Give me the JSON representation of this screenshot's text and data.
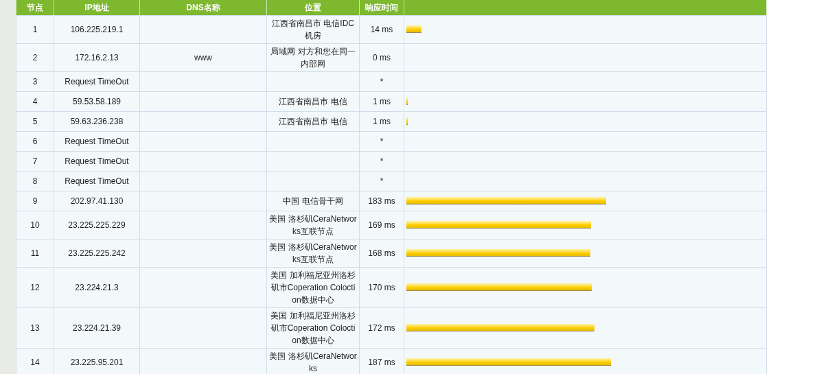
{
  "columns": [
    "节点",
    "IP地址",
    "DNS名称",
    "位置",
    "响应时间"
  ],
  "rows": [
    {
      "hop": "1",
      "ip": "106.225.219.1",
      "location": "江西省南昌市 电信IDC机房",
      "time": "14 ms",
      "level": 0.042
    },
    {
      "hop": "2",
      "ip": "172.16.2.13",
      "dns": "www",
      "location": "局域网 对方和您在同一内部网",
      "time": "0 ms"
    },
    {
      "hop": "3",
      "ip": "Request TimeOut",
      "time": "*"
    },
    {
      "hop": "4",
      "ip": "59.53.58.189",
      "location": "江西省南昌市 电信",
      "time": "1 ms",
      "level": 0.004
    },
    {
      "hop": "5",
      "ip": "59.63.236.238",
      "location": "江西省南昌市 电信",
      "time": "1 ms",
      "level": 0.004
    },
    {
      "hop": "6",
      "ip": "Request TimeOut",
      "time": "*"
    },
    {
      "hop": "7",
      "ip": "Request TimeOut",
      "time": "*"
    },
    {
      "hop": "8",
      "ip": "Request TimeOut",
      "time": "*"
    },
    {
      "hop": "9",
      "ip": "202.97.41.130",
      "location": "中国 电信骨干网",
      "time": "183 ms",
      "level": 0.554
    },
    {
      "hop": "10",
      "ip": "23.225.225.229",
      "location": "美国 洛杉矶CeraNetworks互联节点",
      "time": "169 ms",
      "level": 0.512
    },
    {
      "hop": "11",
      "ip": "23.225.225.242",
      "location": "美国 洛杉矶CeraNetworks互联节点",
      "time": "168 ms",
      "level": 0.509
    },
    {
      "hop": "12",
      "ip": "23.224.21.3",
      "location": "美国 加利福尼亚州洛杉矶市Coperation Coloction数据中心",
      "time": "170 ms",
      "level": 0.514
    },
    {
      "hop": "13",
      "ip": "23.224.21.39",
      "location": "美国 加利福尼亚州洛杉矶市Coperation Coloction数据中心",
      "time": "172 ms",
      "level": 0.52
    },
    {
      "hop": "14",
      "ip": "23.225.95.201",
      "location": "美国 洛杉矶CeraNetworks",
      "time": "187 ms",
      "level": 0.567
    }
  ]
}
